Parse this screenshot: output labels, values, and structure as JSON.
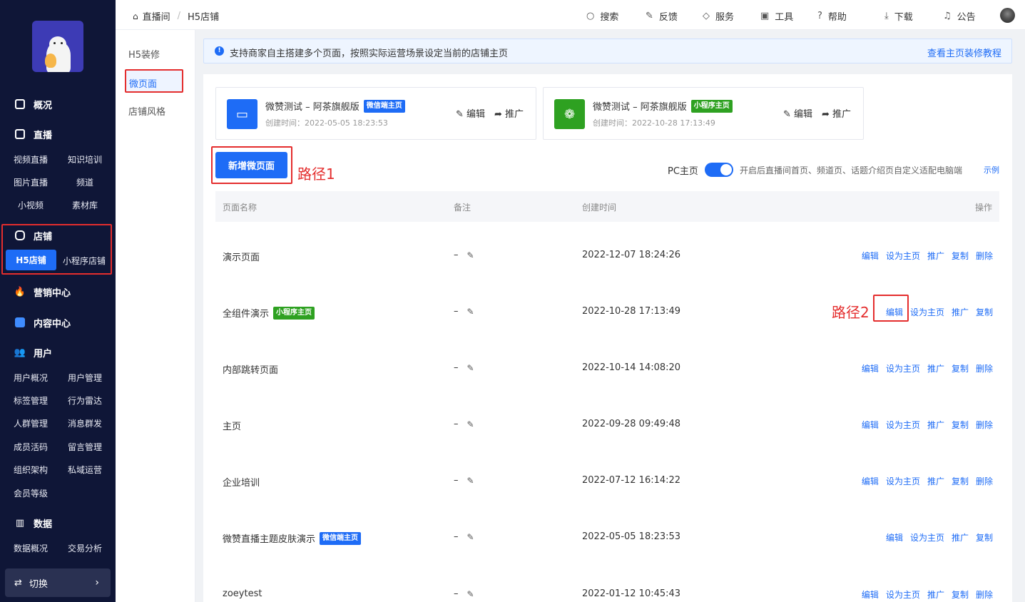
{
  "sidebar": {
    "overview": "概况",
    "live": "直播",
    "live_items": [
      "视频直播",
      "知识培训",
      "图片直播",
      "频道",
      "小视频",
      "素材库"
    ],
    "store": "店铺",
    "store_items": [
      "H5店铺",
      "小程序店铺"
    ],
    "marketing": "营销中心",
    "content": "内容中心",
    "user": "用户",
    "user_items": [
      "用户概况",
      "用户管理",
      "标签管理",
      "行为雷达",
      "人群管理",
      "消息群发",
      "成员活码",
      "留言管理",
      "组织架构",
      "私域运营",
      "会员等级"
    ],
    "data": "数据",
    "data_items": [
      "数据概况",
      "交易分析"
    ],
    "switch": "切换"
  },
  "topbar": {
    "breadcrumb": [
      "直播间",
      "H5店铺"
    ],
    "items": [
      "搜索",
      "反馈",
      "服务",
      "工具",
      "帮助",
      "下载",
      "公告"
    ]
  },
  "subnav": {
    "items": [
      "H5装修",
      "微页面",
      "店铺风格"
    ]
  },
  "notice": {
    "text": "支持商家自主搭建多个页面，按照实际运营场景设定当前的店铺主页",
    "link": "查看主页装修教程"
  },
  "home_cards": [
    {
      "title": "微赞测试 – 阿茶旗舰版",
      "badge": "微信端主页",
      "time": "创建时间：2022-05-05 18:23:53",
      "edit": "编辑",
      "promote": "推广"
    },
    {
      "title": "微赞测试 – 阿茶旗舰版",
      "badge": "小程序主页",
      "time": "创建时间：2022-10-28 17:13:49",
      "edit": "编辑",
      "promote": "推广"
    }
  ],
  "toolbar": {
    "new_button": "新增微页面",
    "path1": "路径1",
    "path2": "路径2",
    "pc_label": "PC主页",
    "pc_enabled": true,
    "pc_desc": "开启后直播间首页、频道页、话题介绍页自定义适配电脑端",
    "pc_example": "示例"
  },
  "table": {
    "headers": [
      "页面名称",
      "备注",
      "创建时间",
      "操作"
    ],
    "rows": [
      {
        "name": "演示页面",
        "badge": "",
        "remark": "–",
        "time": "2022-12-07 18:24:26",
        "actions": [
          "编辑",
          "设为主页",
          "推广",
          "复制",
          "删除"
        ]
      },
      {
        "name": "全组件演示",
        "badge": "小程序主页",
        "remark": "–",
        "time": "2022-10-28 17:13:49",
        "actions": [
          "编辑",
          "设为主页",
          "推广",
          "复制"
        ]
      },
      {
        "name": "内部跳转页面",
        "badge": "",
        "remark": "–",
        "time": "2022-10-14 14:08:20",
        "actions": [
          "编辑",
          "设为主页",
          "推广",
          "复制",
          "删除"
        ]
      },
      {
        "name": "主页",
        "badge": "",
        "remark": "–",
        "time": "2022-09-28 09:49:48",
        "actions": [
          "编辑",
          "设为主页",
          "推广",
          "复制",
          "删除"
        ]
      },
      {
        "name": "企业培训",
        "badge": "",
        "remark": "–",
        "time": "2022-07-12 16:14:22",
        "actions": [
          "编辑",
          "设为主页",
          "推广",
          "复制",
          "删除"
        ]
      },
      {
        "name": "微赞直播主题皮肤演示",
        "badge": "微信端主页",
        "remark": "–",
        "time": "2022-05-05 18:23:53",
        "actions": [
          "编辑",
          "设为主页",
          "推广",
          "复制"
        ]
      },
      {
        "name": "zoeytest",
        "badge": "",
        "remark": "–",
        "time": "2022-01-12 10:45:43",
        "actions": [
          "编辑",
          "设为主页",
          "推广",
          "复制",
          "删除"
        ]
      }
    ]
  },
  "colors": {
    "primary": "#1e6cf6",
    "sidebar_bg": "#0f1637",
    "highlight": "#e42d2d",
    "mini_badge": "#2ea121"
  }
}
